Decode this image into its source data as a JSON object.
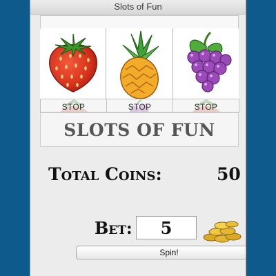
{
  "window": {
    "title": "Slots of Fun"
  },
  "reels": [
    {
      "symbol": "strawberry-icon"
    },
    {
      "symbol": "pineapple-icon"
    },
    {
      "symbol": "grapes-icon"
    }
  ],
  "stop_buttons": [
    {
      "label": "STOP"
    },
    {
      "label": "STOP"
    },
    {
      "label": "STOP"
    }
  ],
  "game": {
    "title": "SLOTS OF FUN",
    "total_coins_label": "Total Coins:",
    "total_coins_value": "50",
    "bet_label": "Bet:",
    "bet_value": "5",
    "spin_label": "Spin!"
  },
  "colors": {
    "background": "#0f5a8c",
    "window": "#ececec"
  }
}
